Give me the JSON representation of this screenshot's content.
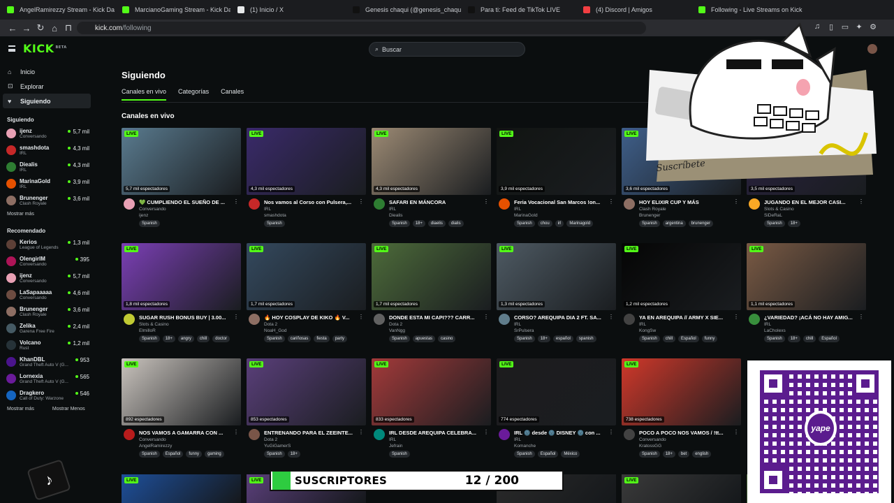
{
  "browser": {
    "tabs": [
      {
        "title": "AngelRamirezzy Stream - Kick Da",
        "color": "#53fc18"
      },
      {
        "title": "MarcianoGaming Stream - Kick Dash",
        "color": "#53fc18"
      },
      {
        "title": "(1) Inicio / X",
        "color": "#e7e9ea"
      },
      {
        "title": "Genesis chaqui (@genesis_chaqui) |",
        "color": "#111111"
      },
      {
        "title": "Para ti: Feed de TikTok LIVE",
        "color": "#111111"
      },
      {
        "title": "(4) Discord | Amigos",
        "color": "#f23f42"
      },
      {
        "title": "Following - Live Streams on Kick",
        "color": "#53fc18"
      }
    ],
    "url_host": "kick.com",
    "url_path": "/following"
  },
  "header": {
    "logo": "KICK",
    "logo_badge": "BETA",
    "search_placeholder": "Buscar"
  },
  "sidebar": {
    "nav": [
      {
        "label": "Inicio",
        "icon": "home-icon",
        "glyph": "⌂",
        "active": false
      },
      {
        "label": "Explorar",
        "icon": "compass-icon",
        "glyph": "⊡",
        "active": false
      },
      {
        "label": "Siguiendo",
        "icon": "heart-icon",
        "glyph": "♥",
        "active": true
      }
    ],
    "following_title": "Siguiendo",
    "following": [
      {
        "name": "ijenz",
        "category": "Conversando",
        "viewers": "5,7 mil",
        "color": "#e8a0b4"
      },
      {
        "name": "smashdota",
        "category": "IRL",
        "viewers": "4,3 mil",
        "color": "#c62828"
      },
      {
        "name": "Diealis",
        "category": "IRL",
        "viewers": "4,3 mil",
        "color": "#2e7d32"
      },
      {
        "name": "MarinaGold",
        "category": "IRL",
        "viewers": "3,9 mil",
        "color": "#e65100"
      },
      {
        "name": "Brunenger",
        "category": "Clash Royale",
        "viewers": "3,6 mil",
        "color": "#8d6e63"
      }
    ],
    "show_more": "Mostrar más",
    "recommended_title": "Recomendado",
    "recommended": [
      {
        "name": "Kerios",
        "category": "League of Legends",
        "viewers": "1,3 mil",
        "color": "#5d4037"
      },
      {
        "name": "OlengirlM",
        "category": "Conversando",
        "viewers": "395",
        "color": "#ad1457"
      },
      {
        "name": "ijenz",
        "category": "Conversando",
        "viewers": "5,7 mil",
        "color": "#e8a0b4"
      },
      {
        "name": "LaSapaaaaa",
        "category": "Conversando",
        "viewers": "4,6 mil",
        "color": "#6d4c41"
      },
      {
        "name": "Brunenger",
        "category": "Clash Royale",
        "viewers": "3,6 mil",
        "color": "#8d6e63"
      },
      {
        "name": "Zelika",
        "category": "Garena Free Fire",
        "viewers": "2,4 mil",
        "color": "#455a64"
      },
      {
        "name": "Volcano",
        "category": "Rust",
        "viewers": "1,2 mil",
        "color": "#263238"
      },
      {
        "name": "KhanDBL",
        "category": "Grand Theft Auto V (G...",
        "viewers": "953",
        "color": "#4a148c"
      },
      {
        "name": "Lornexia",
        "category": "Grand Theft Auto V (G...",
        "viewers": "565",
        "color": "#6a1b9a"
      },
      {
        "name": "Dragkero",
        "category": "Call of Duty: Warzone",
        "viewers": "546",
        "color": "#1565c0"
      }
    ],
    "show_more_2": "Mostrar más",
    "show_less": "Mostrar Menos"
  },
  "main": {
    "title": "Siguiendo",
    "tabs": [
      "Canales en vivo",
      "Categorías",
      "Canales"
    ],
    "section_title": "Canales en vivo",
    "live_label": "LIVE",
    "cards": [
      {
        "viewers": "5,7 mil espectadores",
        "title": "💚 CUMPLIENDO EL SUEÑO DE ...",
        "category": "Conversando",
        "channel": "ijenz",
        "tags": [
          "Spanish"
        ],
        "thumb": "#5a7b8f",
        "avatar": "#e8a0b4"
      },
      {
        "viewers": "4,3 mil espectadores",
        "title": "Nos vamos al Corso con Pulsera,...",
        "category": "IRL",
        "channel": "smashdota",
        "tags": [
          "Spanish"
        ],
        "thumb": "#3a2a6a",
        "avatar": "#c62828"
      },
      {
        "viewers": "4,3 mil espectadores",
        "title": "SAFARI EN MÁNCORA",
        "category": "IRL",
        "channel": "Diealis",
        "tags": [
          "Spanish",
          "18+",
          "diaelis",
          "dialis"
        ],
        "thumb": "#9c8a74",
        "avatar": "#2e7d32"
      },
      {
        "viewers": "3,9 mil espectadores",
        "title": "Feria Vocacional San Marcos !on...",
        "category": "IRL",
        "channel": "MarinaGold",
        "tags": [
          "Spanish",
          "chou",
          "irl",
          "Marinagold"
        ],
        "thumb": "#111412",
        "avatar": "#e65100"
      },
      {
        "viewers": "3,6 mil espectadores",
        "title": "HOY ELIXIR CUP Y MÁS",
        "category": "Clash Royale",
        "channel": "Brunenger",
        "tags": [
          "Spanish",
          "argentina",
          "brunenger"
        ],
        "thumb": "#3f5f8a",
        "avatar": "#8d6e63"
      },
      {
        "viewers": "3,5 mil espectadores",
        "title": "JUGANDO EN EL MEJOR CASI...",
        "category": "Slots & Casino",
        "channel": "SiDeRaL",
        "tags": [
          "Spanish",
          "18+"
        ],
        "thumb": "#2a2240",
        "avatar": "#f9a825"
      },
      {
        "viewers": "1,8 mil espectadores",
        "title": "SUGAR RUSH BONUS BUY | 3.00...",
        "category": "Slots & Casino",
        "channel": "ElmilloR",
        "tags": [
          "Spanish",
          "18+",
          "angry",
          "chill",
          "doctor"
        ],
        "thumb": "#7b3fb5",
        "avatar": "#c0ca33"
      },
      {
        "viewers": "1,7 mil espectadores",
        "title": "🔥 HOY COSPLAY DE KIKO 🔥 V...",
        "category": "Dota 2",
        "channel": "NoaH_God",
        "tags": [
          "Spanish",
          "cariñosas",
          "fiesta",
          "party"
        ],
        "thumb": "#34495e",
        "avatar": "#8d6e63"
      },
      {
        "viewers": "1,7 mil espectadores",
        "title": "DONDE ESTA MI CAPI??? CARR...",
        "category": "Dota 2",
        "channel": "VanNgg",
        "tags": [
          "Spanish",
          "apuestas",
          "casino"
        ],
        "thumb": "#4d6b3a",
        "avatar": "#616161"
      },
      {
        "viewers": "1,3 mil espectadores",
        "title": "CORSO? AREQUIPA DIA 2 FT. SA...",
        "category": "IRL",
        "channel": "SrPulsera",
        "tags": [
          "Spanish",
          "18+",
          "español",
          "spanish"
        ],
        "thumb": "#4e5a63",
        "avatar": "#607d8b"
      },
      {
        "viewers": "1,2 mil espectadores",
        "title": "YA EN AREQUIPA // ARMY X SIE...",
        "category": "IRL",
        "channel": "KongSw",
        "tags": [
          "Spanish",
          "chill",
          "Español",
          "funny"
        ],
        "thumb": "#050505",
        "avatar": "#424242"
      },
      {
        "viewers": "1,1 mil espectadores",
        "title": "¿VARIEDAD? ¡ACÁ NO HAY AMIG...",
        "category": "IRL",
        "channel": "LaCholexs",
        "tags": [
          "Spanish",
          "18+",
          "chill",
          "Español"
        ],
        "thumb": "#7a5a44",
        "avatar": "#388e3c"
      },
      {
        "viewers": "892 espectadores",
        "title": "NOS VAMOS A GAMARRA CON ...",
        "category": "Conversando",
        "channel": "AngelRamirezzy",
        "tags": [
          "Spanish",
          "Español",
          "funny",
          "gaming"
        ],
        "thumb": "#c9c3bd",
        "avatar": "#b71c1c"
      },
      {
        "viewers": "853 espectadores",
        "title": "ENTRENANDO PARA EL ZEEINTE...",
        "category": "Dota 2",
        "channel": "YuGiGamerS",
        "tags": [
          "Spanish",
          "18+"
        ],
        "thumb": "#5a3f7a",
        "avatar": "#795548"
      },
      {
        "viewers": "833 espectadores",
        "title": "IRL DESDE AREQUIPA CELEBRA...",
        "category": "IRL",
        "channel": "Jefrain",
        "tags": [
          "Spanish"
        ],
        "thumb": "#a33a3a",
        "avatar": "#00897b"
      },
      {
        "viewers": "774 espectadores",
        "title": "IRL 🌚 desde 🌚 DISNEY 🌚 con ...",
        "category": "IRL",
        "channel": "Komanche",
        "tags": [
          "Spanish",
          "Español",
          "México"
        ],
        "thumb": "#1d1c1e",
        "avatar": "#6a1b9a"
      },
      {
        "viewers": "738 espectadores",
        "title": "POCO A POCO NOS VAMOS / !tt...",
        "category": "Conversando",
        "channel": "KratossGG",
        "tags": [
          "Spanish",
          "18+",
          "bet",
          "english"
        ],
        "thumb": "#d0382a",
        "avatar": "#424242"
      }
    ]
  },
  "overlays": {
    "subscribers_label": "SUSCRIPTORES",
    "subscribers_count": "12 / 200",
    "qr_brand": "yape",
    "sticker_text": "Suscríbete"
  },
  "colors": {
    "accent": "#53fc18",
    "background": "#0b0e0f",
    "yape": "#5b1c8e"
  }
}
